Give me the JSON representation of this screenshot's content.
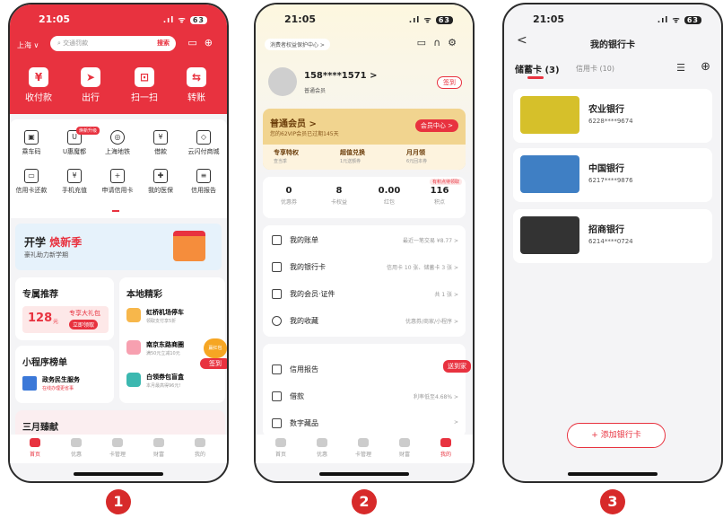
{
  "phone1": {
    "time": "21:05",
    "signal": ".ıl ᯤ",
    "battery": "63",
    "location": "上海 ∨",
    "search_placeholder": "交通罚款",
    "search_button": "搜索",
    "top_actions": [
      {
        "label": "收付款",
        "icon": "¥"
      },
      {
        "label": "出行",
        "icon": "➤"
      },
      {
        "label": "扫一扫",
        "icon": "⊡"
      },
      {
        "label": "转账",
        "icon": "⇆"
      }
    ],
    "grid_row1": [
      "乘车码",
      "U惠魔都",
      "上海地铁",
      "借款",
      "云闪付商城"
    ],
    "grid_row1_tag": "焕新升级",
    "grid_row2": [
      "信用卡还款",
      "手机充值",
      "申请信用卡",
      "我的医保",
      "信用报告"
    ],
    "banner_title_a": "开学",
    "banner_title_b": "焕新季",
    "banner_sub": "豪礼助力新学期",
    "exclusive_title": "专属推荐",
    "exclusive_price": "128",
    "exclusive_unit": "元",
    "exclusive_pack": "专享大礼包",
    "exclusive_btn": "立即领取",
    "local_title": "本地精彩",
    "local_items": [
      {
        "name": "虹桥机场停车",
        "sub": "领取支付享5折"
      },
      {
        "name": "南京东路商圈",
        "sub": "满50元立减10元"
      },
      {
        "name": "白领券包盲盒",
        "sub": "本月最高得96元!"
      }
    ],
    "mini_title": "小程序榜单",
    "mini_item": "政务民生服务",
    "mini_sub": "在线办理更省事",
    "signin": "签到",
    "signin_top": "赢红包",
    "march_title": "三月臻献",
    "tabs": [
      "首页",
      "优惠",
      "卡管理",
      "财富",
      "我的"
    ]
  },
  "phone2": {
    "time": "21:05",
    "battery": "63",
    "consumer_pill": "消费者权益保护中心 >",
    "phone_no": "158****1571 >",
    "member_label": "普通会员",
    "signin": "签到",
    "vip_title": "普通会员 >",
    "vip_sub": "您的62VIP会员已过期145天",
    "vip_btn": "会员中心 >",
    "privileges": [
      {
        "t": "专享特权",
        "s": "查当季"
      },
      {
        "t": "超值兑换",
        "s": "1元送额券"
      },
      {
        "t": "月月领",
        "s": "6元回本券"
      }
    ],
    "stats_tag": "有积点待领取",
    "stats": [
      {
        "n": "0",
        "l": "优惠券"
      },
      {
        "n": "8",
        "l": "卡权益"
      },
      {
        "n": "0.00",
        "l": "红包"
      },
      {
        "n": "116",
        "l": "积点"
      }
    ],
    "menu1": [
      {
        "l": "我的账单",
        "d": "最近一笔交易 ¥8.77 >"
      },
      {
        "l": "我的银行卡",
        "d": "信用卡 10 张、储蓄卡 3 张 >"
      },
      {
        "l": "我的会员·证件",
        "d": "共 1 张 >"
      },
      {
        "l": "我的收藏",
        "d": "优惠券/商家/小程序 >"
      }
    ],
    "menu2": [
      {
        "l": "信用报告",
        "d": ""
      },
      {
        "l": "借款",
        "d": "利率低至4.68% >"
      },
      {
        "l": "数字藏品",
        "d": ">"
      }
    ],
    "delivery": "送到家",
    "tabs": [
      "首页",
      "优惠",
      "卡管理",
      "财富",
      "我的"
    ]
  },
  "phone3": {
    "time": "21:05",
    "battery": "63",
    "back": "<",
    "title": "我的银行卡",
    "tab_debit": "储蓄卡",
    "tab_debit_count": "(3)",
    "tab_credit": "信用卡 (10)",
    "cards": [
      {
        "name": "农业银行",
        "no": "6228****9674",
        "color": "#d6c02a"
      },
      {
        "name": "中国银行",
        "no": "6217****9876",
        "color": "#3f7fc4"
      },
      {
        "name": "招商银行",
        "no": "6214****0724",
        "color": "#333333"
      }
    ],
    "add_btn": "+ 添加银行卡"
  },
  "steps": [
    "1",
    "2",
    "3"
  ]
}
